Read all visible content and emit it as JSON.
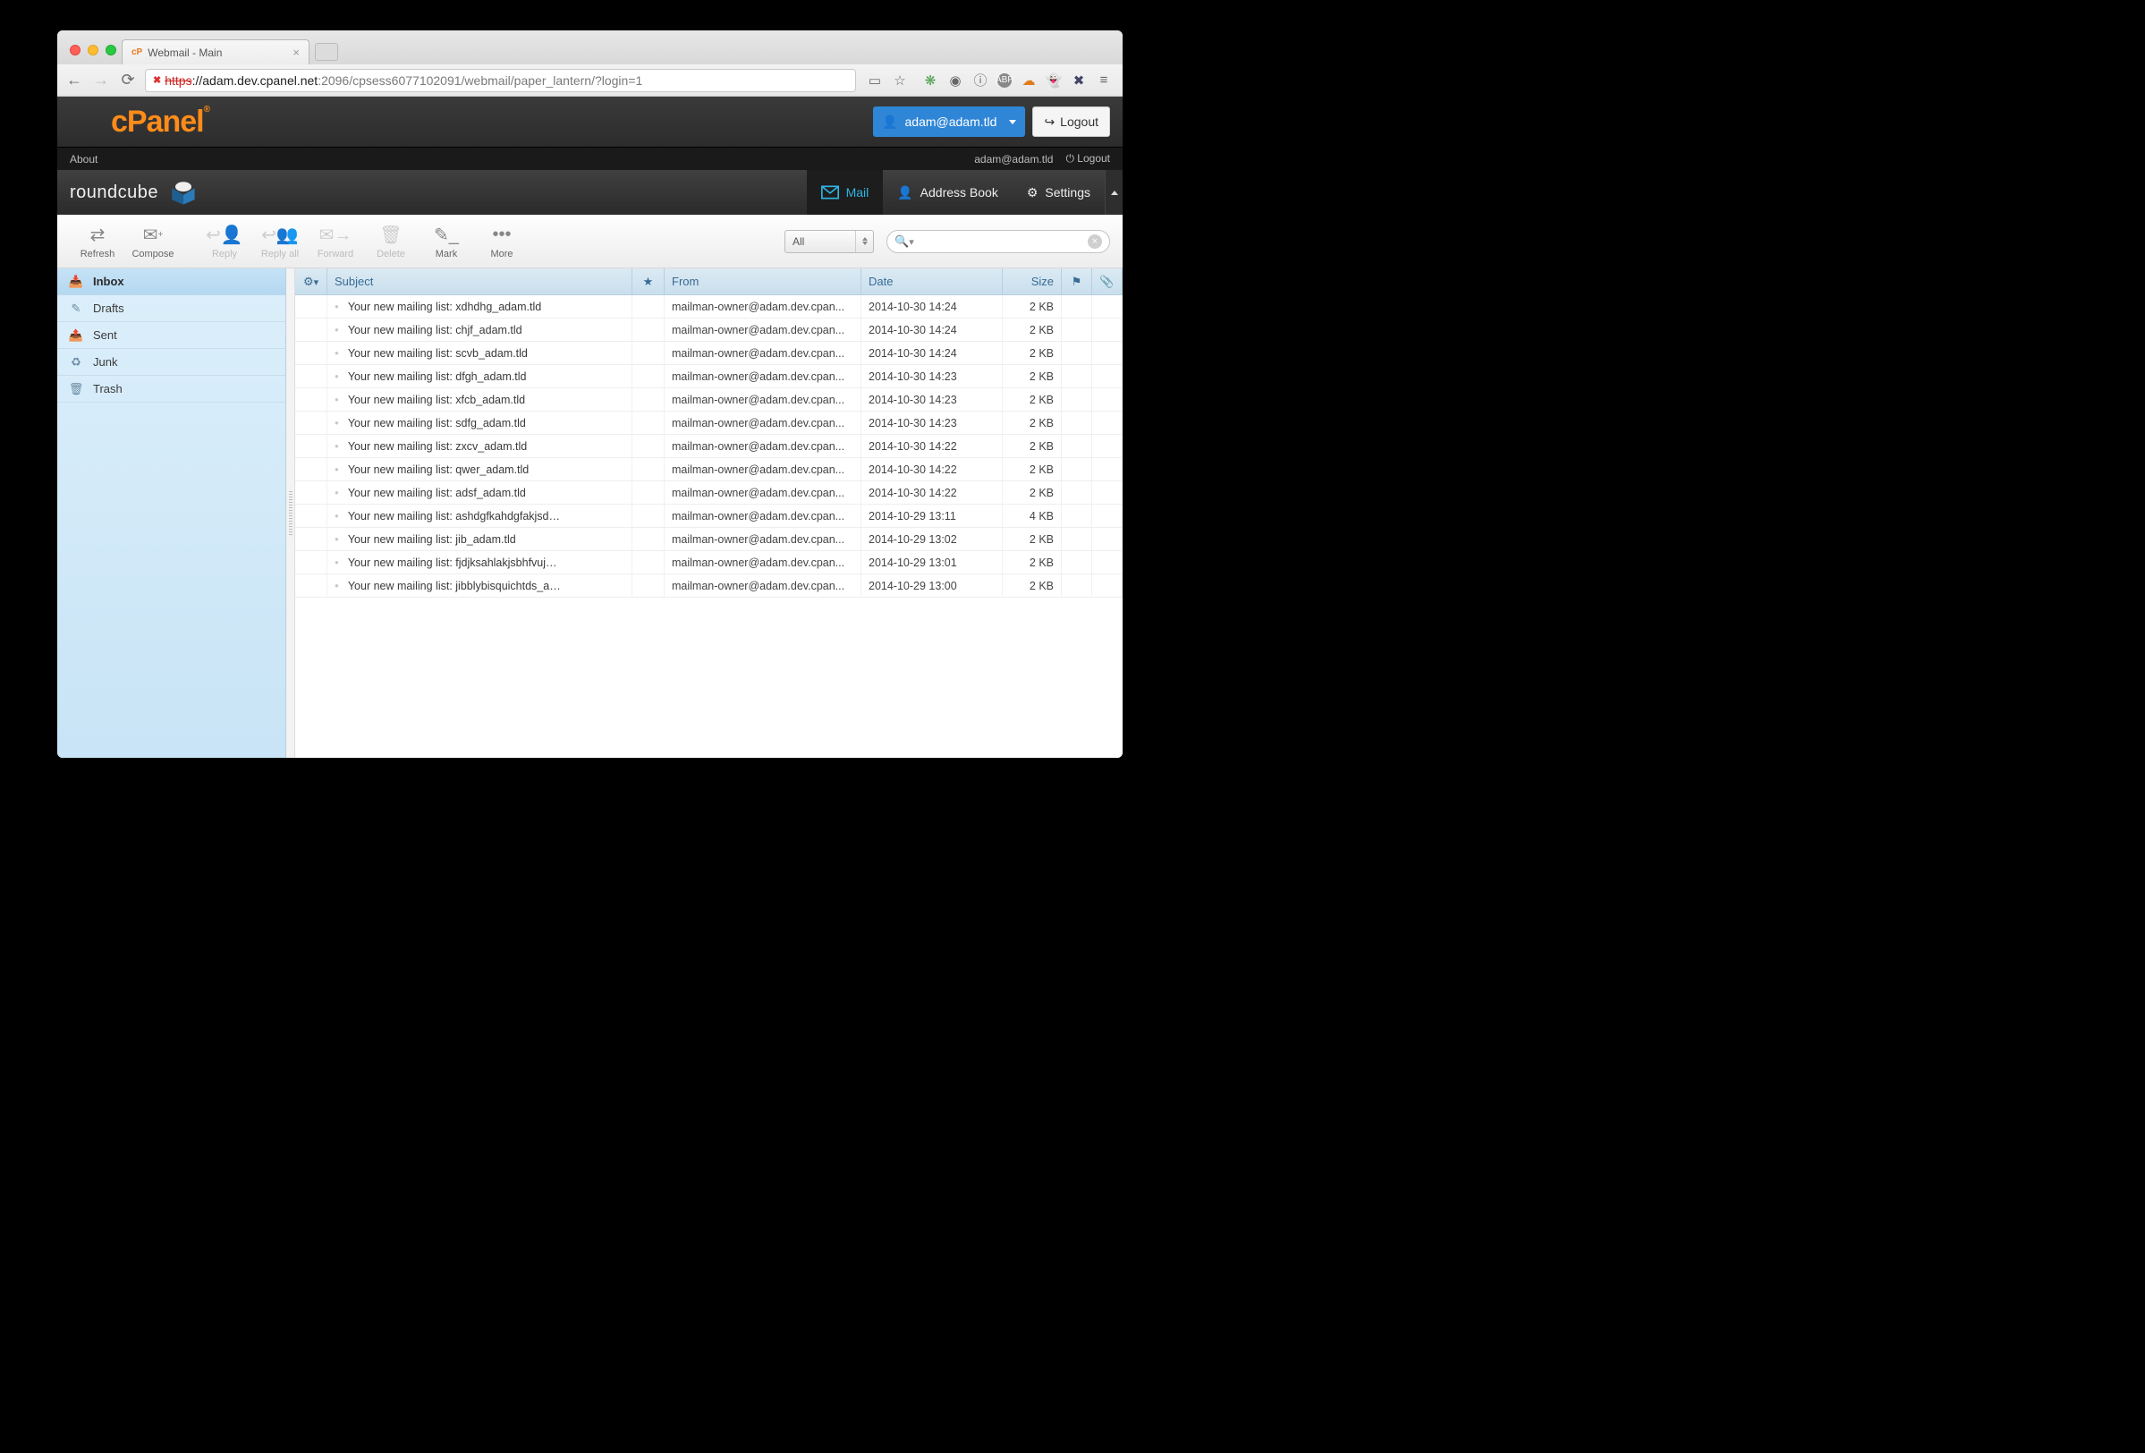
{
  "browser": {
    "tab_title": "Webmail - Main",
    "url_https": "https",
    "url_host": "://adam.dev.cpanel.net",
    "url_path": ":2096/cpsess6077102091/webmail/paper_lantern/?login=1"
  },
  "cpanel": {
    "user": "adam@adam.tld",
    "logout": "Logout"
  },
  "roundcube": {
    "topbar": {
      "about": "About",
      "email": "adam@adam.tld",
      "logout": "Logout"
    },
    "nav": {
      "mail": "Mail",
      "addressbook": "Address Book",
      "settings": "Settings"
    },
    "toolbar": {
      "refresh": "Refresh",
      "compose": "Compose",
      "reply": "Reply",
      "replyall": "Reply all",
      "forward": "Forward",
      "delete": "Delete",
      "mark": "Mark",
      "more": "More",
      "filter": "All",
      "search_placeholder": ""
    },
    "folders": {
      "inbox": "Inbox",
      "drafts": "Drafts",
      "sent": "Sent",
      "junk": "Junk",
      "trash": "Trash"
    },
    "columns": {
      "subject": "Subject",
      "from": "From",
      "date": "Date",
      "size": "Size"
    },
    "messages": [
      {
        "subject": "Your new mailing list: xdhdhg_adam.tld",
        "from": "mailman-owner@adam.dev.cpan...",
        "date": "2014-10-30 14:24",
        "size": "2 KB"
      },
      {
        "subject": "Your new mailing list: chjf_adam.tld",
        "from": "mailman-owner@adam.dev.cpan...",
        "date": "2014-10-30 14:24",
        "size": "2 KB"
      },
      {
        "subject": "Your new mailing list: scvb_adam.tld",
        "from": "mailman-owner@adam.dev.cpan...",
        "date": "2014-10-30 14:24",
        "size": "2 KB"
      },
      {
        "subject": "Your new mailing list: dfgh_adam.tld",
        "from": "mailman-owner@adam.dev.cpan...",
        "date": "2014-10-30 14:23",
        "size": "2 KB"
      },
      {
        "subject": "Your new mailing list: xfcb_adam.tld",
        "from": "mailman-owner@adam.dev.cpan...",
        "date": "2014-10-30 14:23",
        "size": "2 KB"
      },
      {
        "subject": "Your new mailing list: sdfg_adam.tld",
        "from": "mailman-owner@adam.dev.cpan...",
        "date": "2014-10-30 14:23",
        "size": "2 KB"
      },
      {
        "subject": "Your new mailing list: zxcv_adam.tld",
        "from": "mailman-owner@adam.dev.cpan...",
        "date": "2014-10-30 14:22",
        "size": "2 KB"
      },
      {
        "subject": "Your new mailing list: qwer_adam.tld",
        "from": "mailman-owner@adam.dev.cpan...",
        "date": "2014-10-30 14:22",
        "size": "2 KB"
      },
      {
        "subject": "Your new mailing list: adsf_adam.tld",
        "from": "mailman-owner@adam.dev.cpan...",
        "date": "2014-10-30 14:22",
        "size": "2 KB"
      },
      {
        "subject": "Your new mailing list: ashdgfkahdgfakjsd…",
        "from": "mailman-owner@adam.dev.cpan...",
        "date": "2014-10-29 13:11",
        "size": "4 KB"
      },
      {
        "subject": "Your new mailing list: jib_adam.tld",
        "from": "mailman-owner@adam.dev.cpan...",
        "date": "2014-10-29 13:02",
        "size": "2 KB"
      },
      {
        "subject": "Your new mailing list: fjdjksahlakjsbhfvuj…",
        "from": "mailman-owner@adam.dev.cpan...",
        "date": "2014-10-29 13:01",
        "size": "2 KB"
      },
      {
        "subject": "Your new mailing list: jibblybisquichtds_a…",
        "from": "mailman-owner@adam.dev.cpan...",
        "date": "2014-10-29 13:00",
        "size": "2 KB"
      }
    ]
  }
}
